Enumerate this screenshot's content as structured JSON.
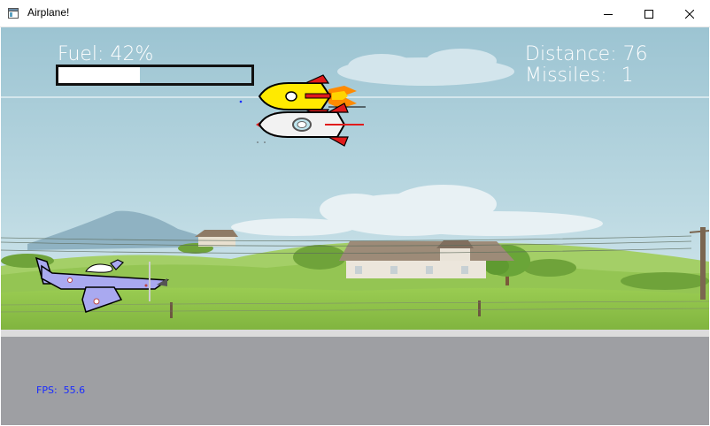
{
  "window": {
    "title": "Airplane!",
    "controls": [
      "minimize",
      "maximize",
      "close"
    ]
  },
  "hud": {
    "fuel_label": "Fuel:",
    "fuel_value": "42%",
    "fuel_fraction": 0.42,
    "distance_label": "Distance:",
    "distance_value": "76",
    "missiles_label": "Missiles:",
    "missiles_value": "1",
    "fps_label": "FPS:",
    "fps_value": "55.6"
  },
  "colors": {
    "sky": "#a8ccd9",
    "grass": "#8cc04a",
    "road": "#9e9fa3",
    "hud_text": "#ffffff",
    "fps_text": "#1a2cff",
    "rocket_yellow": "#ffea00",
    "rocket_white": "#f2f2f2",
    "plane": "#a9a9f0"
  },
  "sprites": [
    "player-airplane",
    "yellow-rocket",
    "white-rocket"
  ]
}
